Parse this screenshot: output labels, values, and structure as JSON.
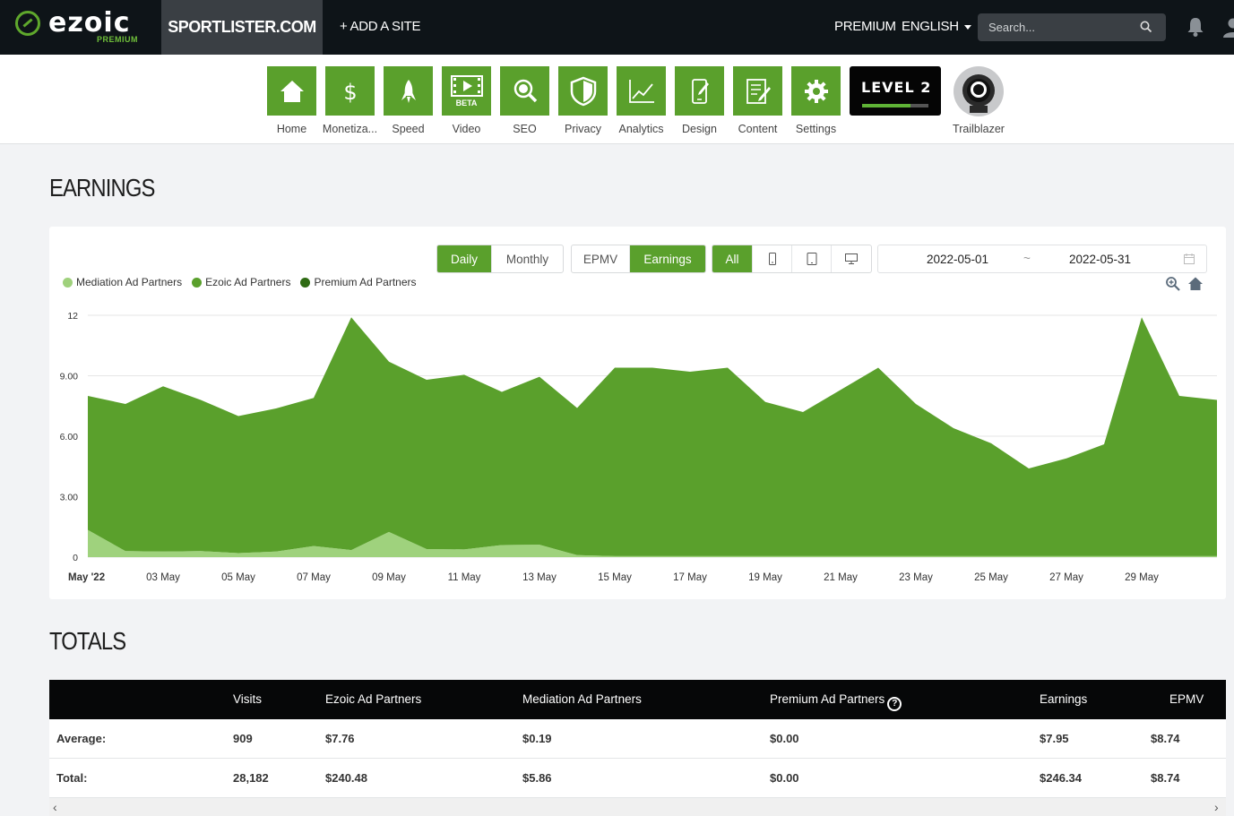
{
  "header": {
    "logo_text": "ezoic",
    "logo_sub": "PREMIUM",
    "site": "SPORTLISTER.COM",
    "add_site": "+ ADD A SITE",
    "premium": "PREMIUM",
    "language": "ENGLISH",
    "search_placeholder": "Search...",
    "icons": [
      "search-icon",
      "bell-icon",
      "user-icon"
    ]
  },
  "toolbar": {
    "items": [
      {
        "label": "Home",
        "icon": "home-icon"
      },
      {
        "label": "Monetiza...",
        "icon": "dollar-icon"
      },
      {
        "label": "Speed",
        "icon": "rocket-icon"
      },
      {
        "label": "Video",
        "icon": "video-icon",
        "badge": "BETA"
      },
      {
        "label": "SEO",
        "icon": "magnifier-icon"
      },
      {
        "label": "Privacy",
        "icon": "shield-icon"
      },
      {
        "label": "Analytics",
        "icon": "line-chart-icon"
      },
      {
        "label": "Design",
        "icon": "mobile-edit-icon"
      },
      {
        "label": "Content",
        "icon": "document-edit-icon"
      },
      {
        "label": "Settings",
        "icon": "gear-icon"
      }
    ],
    "level": {
      "label": "LEVEL 2",
      "progress": 0.73
    },
    "trailblazer": "Trailblazer"
  },
  "earnings": {
    "title": "EARNINGS",
    "period_buttons": [
      "Daily",
      "Monthly"
    ],
    "metric_buttons": [
      "EPMV",
      "Earnings"
    ],
    "device_buttons": [
      "All"
    ],
    "device_icons": [
      "mobile-icon",
      "tablet-icon",
      "desktop-icon"
    ],
    "date_from": "2022-05-01",
    "date_sep": "~",
    "date_to": "2022-05-31",
    "colors": {
      "accent": "#5aa02c",
      "mediation": "#9fd17c",
      "ezoic": "#5aa02c",
      "premium": "#2f6b14"
    }
  },
  "chart_data": {
    "type": "area",
    "stacked": true,
    "x": [
      "2022-05-01",
      "2022-05-02",
      "2022-05-03",
      "2022-05-04",
      "2022-05-05",
      "2022-05-06",
      "2022-05-07",
      "2022-05-08",
      "2022-05-09",
      "2022-05-10",
      "2022-05-11",
      "2022-05-12",
      "2022-05-13",
      "2022-05-14",
      "2022-05-15",
      "2022-05-16",
      "2022-05-17",
      "2022-05-18",
      "2022-05-19",
      "2022-05-20",
      "2022-05-21",
      "2022-05-22",
      "2022-05-23",
      "2022-05-24",
      "2022-05-25",
      "2022-05-26",
      "2022-05-27",
      "2022-05-28",
      "2022-05-29",
      "2022-05-30",
      "2022-05-31"
    ],
    "x_ticks": [
      "May '22",
      "03 May",
      "05 May",
      "07 May",
      "09 May",
      "11 May",
      "13 May",
      "15 May",
      "17 May",
      "19 May",
      "21 May",
      "23 May",
      "25 May",
      "27 May",
      "29 May"
    ],
    "y_ticks": [
      "0",
      "3.00",
      "6.00",
      "9.00",
      "12"
    ],
    "ylim": [
      0,
      12
    ],
    "series": [
      {
        "name": "Mediation Ad Partners",
        "values": [
          1.35,
          0.3,
          0.28,
          0.3,
          0.2,
          0.28,
          0.55,
          0.35,
          1.25,
          0.4,
          0.38,
          0.6,
          0.62,
          0.1,
          0.05,
          0.05,
          0.05,
          0.05,
          0.05,
          0.05,
          0.05,
          0.05,
          0.05,
          0.05,
          0.05,
          0.05,
          0.05,
          0.05,
          0.05,
          0.05,
          0.05
        ]
      },
      {
        "name": "Ezoic Ad Partners",
        "values": [
          6.65,
          7.3,
          8.2,
          7.5,
          6.8,
          7.1,
          7.35,
          11.55,
          8.45,
          8.4,
          8.67,
          7.6,
          8.33,
          7.3,
          9.35,
          9.35,
          9.15,
          9.35,
          7.65,
          7.15,
          8.25,
          9.35,
          7.55,
          6.35,
          5.6,
          4.35,
          4.85,
          5.55,
          11.85,
          7.95,
          7.75
        ]
      },
      {
        "name": "Premium Ad Partners",
        "values": [
          0,
          0,
          0,
          0,
          0,
          0,
          0,
          0,
          0,
          0,
          0,
          0,
          0,
          0,
          0,
          0,
          0,
          0,
          0,
          0,
          0,
          0,
          0,
          0,
          0,
          0,
          0,
          0,
          0,
          0,
          0
        ]
      }
    ]
  },
  "totals": {
    "title": "TOTALS",
    "columns": [
      "",
      "Visits",
      "Ezoic Ad Partners",
      "Mediation Ad Partners",
      "Premium Ad Partners",
      "Earnings",
      "EPMV"
    ],
    "rows": [
      [
        "Average:",
        "909",
        "$7.76",
        "$0.19",
        "$0.00",
        "$7.95",
        "$8.74"
      ],
      [
        "Total:",
        "28,182",
        "$240.48",
        "$5.86",
        "$0.00",
        "$246.34",
        "$8.74"
      ]
    ]
  }
}
